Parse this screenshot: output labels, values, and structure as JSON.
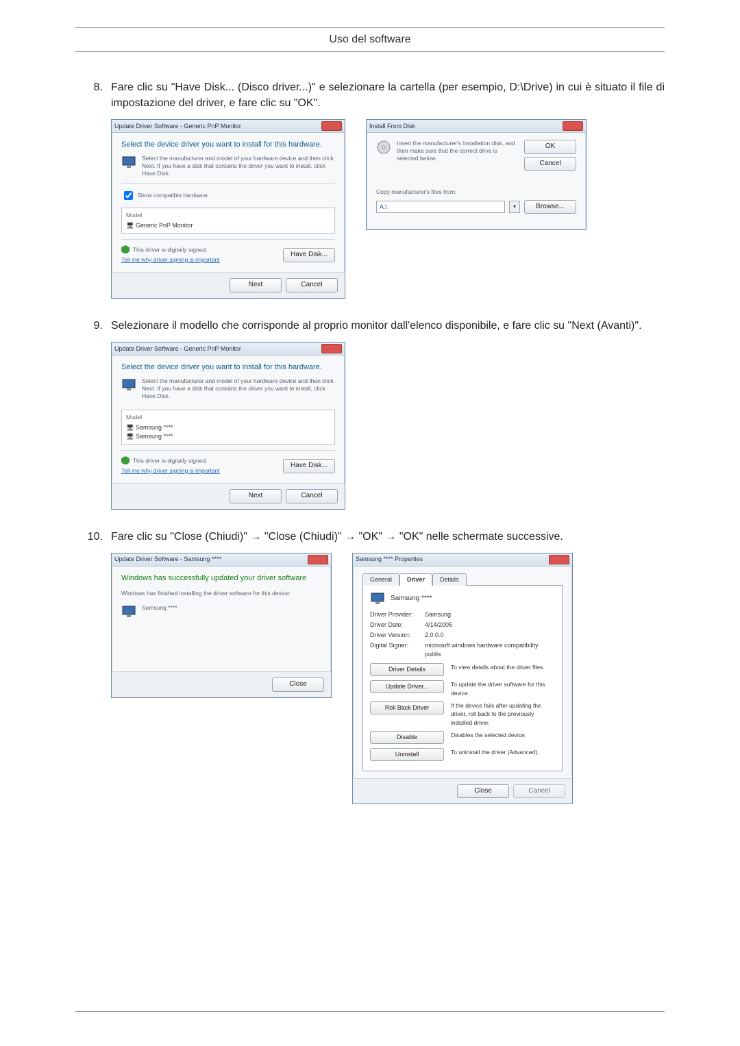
{
  "header": {
    "title": "Uso del software"
  },
  "steps": [
    {
      "num": "8.",
      "text": "Fare clic su \"Have Disk... (Disco driver...)\" e selezionare la cartella (per esempio, D:\\Drive) in cui è situato il file di impostazione del driver, e fare clic su \"OK\"."
    },
    {
      "num": "9.",
      "text": "Selezionare il modello che corrisponde al proprio monitor dall'elenco disponibile, e fare clic su \"Next (Avanti)\"."
    },
    {
      "num": "10.",
      "text": "Fare clic su \"Close (Chiudi)\" → \"Close (Chiudi)\" → \"OK\" → \"OK\" nelle schermate successive."
    }
  ],
  "dlg_update1": {
    "title": "Update Driver Software - Generic PnP Monitor",
    "heading": "Select the device driver you want to install for this hardware.",
    "subtext": "Select the manufacturer and model of your hardware device and then click Next. If you have a disk that contains the driver you want to install, click Have Disk.",
    "show_compatible": "Show compatible hardware",
    "list_header": "Model",
    "list_item": "Generic PnP Monitor",
    "signed": "This driver is digitally signed.",
    "signed_link": "Tell me why driver signing is important",
    "btn_havedisk": "Have Disk...",
    "btn_next": "Next",
    "btn_cancel": "Cancel"
  },
  "dlg_install": {
    "title": "Install From Disk",
    "msg": "Insert the manufacturer's installation disk, and then make sure that the correct drive is selected below.",
    "copyfrom": "Copy manufacturer's files from:",
    "path": "A:\\",
    "btn_ok": "OK",
    "btn_cancel": "Cancel",
    "btn_browse": "Browse..."
  },
  "dlg_update2": {
    "title": "Update Driver Software - Generic PnP Monitor",
    "heading": "Select the device driver you want to install for this hardware.",
    "subtext": "Select the manufacturer and model of your hardware device and then click Next. If you have a disk that contains the driver you want to install, click Have Disk.",
    "list_header": "Model",
    "list_item1": "Samsung ****",
    "list_item2": "Samsung ****",
    "signed": "This driver is digitally signed.",
    "signed_link": "Tell me why driver signing is important",
    "btn_havedisk": "Have Disk...",
    "btn_next": "Next",
    "btn_cancel": "Cancel"
  },
  "dlg_done": {
    "title": "Update Driver Software - Samsung ****",
    "heading": "Windows has successfully updated your driver software",
    "subtext": "Windows has finished installing the driver software for this device:",
    "device": "Samsung ****",
    "btn_close": "Close"
  },
  "dlg_props": {
    "title": "Samsung **** Properties",
    "tab_general": "General",
    "tab_driver": "Driver",
    "tab_details": "Details",
    "device": "Samsung ****",
    "provider_k": "Driver Provider:",
    "provider_v": "Samsung",
    "date_k": "Driver Date:",
    "date_v": "4/14/2005",
    "version_k": "Driver Version:",
    "version_v": "2.0.0.0",
    "signer_k": "Digital Signer:",
    "signer_v": "microsoft windows hardware compatibility publis",
    "btn_details": "Driver Details",
    "desc_details": "To view details about the driver files.",
    "btn_update": "Update Driver...",
    "desc_update": "To update the driver software for this device.",
    "btn_rollback": "Roll Back Driver",
    "desc_rollback": "If the device fails after updating the driver, roll back to the previously installed driver.",
    "btn_disable": "Disable",
    "desc_disable": "Disables the selected device.",
    "btn_uninstall": "Uninstall",
    "desc_uninstall": "To uninstall the driver (Advanced).",
    "btn_close": "Close",
    "btn_cancel": "Cancel"
  }
}
